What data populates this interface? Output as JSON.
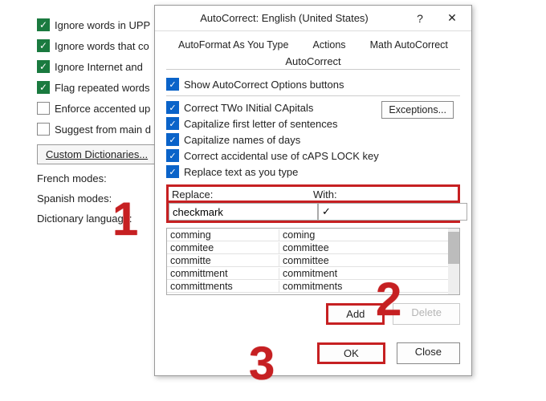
{
  "bg": {
    "opts": [
      "Ignore words in UPP",
      "Ignore words that co",
      "Ignore Internet and ",
      "Flag repeated words",
      "Enforce accented up",
      "Suggest from main d"
    ],
    "checked": [
      true,
      true,
      true,
      true,
      false,
      false
    ],
    "custom_dict_btn": "Custom Dictionaries...",
    "labels": [
      "French modes:",
      "Spanish modes:",
      "Dictionary language:"
    ]
  },
  "dlg": {
    "title": "AutoCorrect: English (United States)",
    "help": "?",
    "close": "✕",
    "tabs_top": [
      "AutoFormat As You Type",
      "Actions",
      "Math AutoCorrect"
    ],
    "tab_active": "AutoCorrect",
    "show_btns": "Show AutoCorrect Options buttons",
    "rules": [
      "Correct TWo INitial CApitals",
      "Capitalize first letter of sentences",
      "Capitalize names of days",
      "Correct accidental use of cAPS LOCK key",
      "Replace text as you type"
    ],
    "exceptions": "Exceptions...",
    "replace_lbl": "Replace:",
    "with_lbl": "With:",
    "replace_val": "checkmark",
    "with_val": "✓",
    "list": [
      [
        "comming",
        "coming"
      ],
      [
        "commitee",
        "committee"
      ],
      [
        "committe",
        "committee"
      ],
      [
        "committment",
        "commitment"
      ],
      [
        "committments",
        "commitments"
      ]
    ],
    "add": "Add",
    "delete": "Delete",
    "ok": "OK",
    "close_btn": "Close"
  },
  "anno": {
    "n1": "1",
    "n2": "2",
    "n3": "3"
  }
}
